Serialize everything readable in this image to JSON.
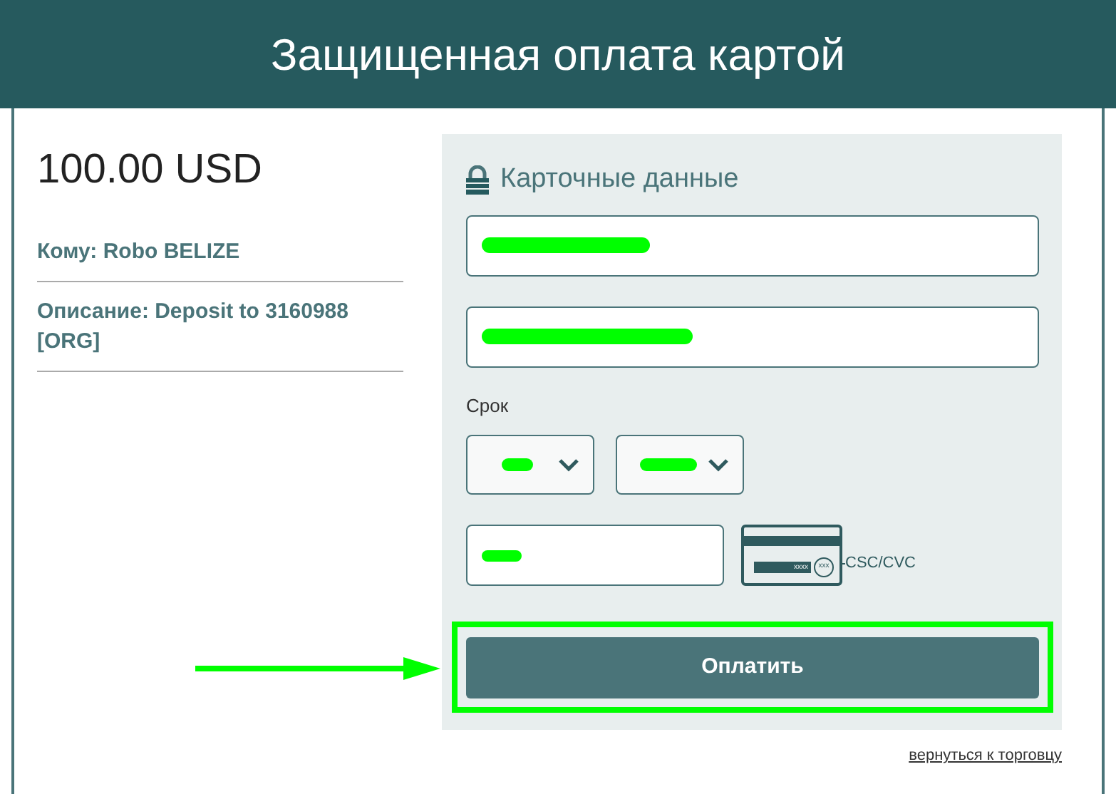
{
  "header": {
    "title": "Защищенная оплата картой"
  },
  "summary": {
    "amount": "100.00 USD",
    "details": [
      "Кому: Robo BELIZE",
      "Описание: Deposit to 3160988 [ORG]"
    ]
  },
  "card_form": {
    "title": "Карточные данные",
    "fields": [
      {
        "kind": "cardholder"
      },
      {
        "kind": "card_number"
      }
    ],
    "expiry_label": "Срок",
    "expiry_selects": [
      {
        "kind": "month"
      },
      {
        "kind": "year"
      }
    ],
    "cvc": {
      "card_number_mask": "xxxx",
      "code_mask": "xxx",
      "label": "CSC/CVC"
    },
    "pay_button": "Оплатить"
  },
  "back_link": "вернуться к торговцу"
}
